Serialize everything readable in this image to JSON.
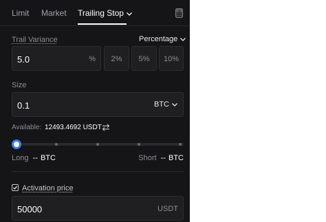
{
  "tabs": {
    "limit": "Limit",
    "market": "Market",
    "trailing_stop": "Trailing Stop"
  },
  "trail_variance": {
    "label": "Trail Variance",
    "mode": "Percentage",
    "value": "5.0",
    "unit": "%",
    "presets": [
      "2%",
      "5%",
      "10%"
    ]
  },
  "size": {
    "label": "Size",
    "value": "0.1",
    "currency": "BTC"
  },
  "available": {
    "label": "Available:",
    "amount": "12493.4692 USDT"
  },
  "slider": {
    "value_fraction": 0
  },
  "long": {
    "label": "Long",
    "value": "--",
    "unit": "BTC"
  },
  "short": {
    "label": "Short",
    "value": "--",
    "unit": "BTC"
  },
  "activation": {
    "label": "Activation price",
    "checked": true,
    "value": "50000",
    "unit": "USDT"
  },
  "colors": {
    "background": "#151517",
    "accent": "#3d7bf7"
  }
}
